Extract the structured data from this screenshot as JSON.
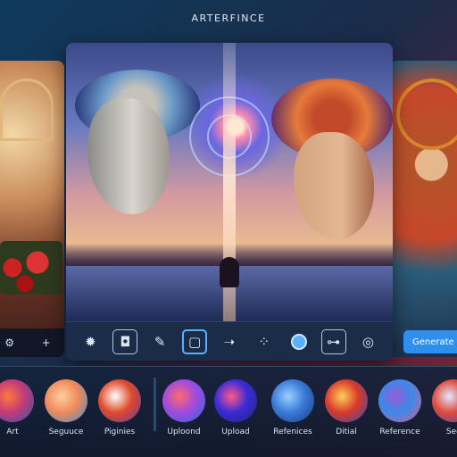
{
  "app": {
    "title": "ARTERFINCE"
  },
  "left_panel": {
    "tools": [
      {
        "icon": "settings-icon",
        "glyph": "⚙"
      },
      {
        "icon": "plus-icon",
        "glyph": "+"
      }
    ]
  },
  "main": {
    "toolbar": [
      {
        "icon": "sun-icon",
        "glyph": "✹"
      },
      {
        "icon": "crop-frame-icon",
        "glyph": "◘"
      },
      {
        "icon": "brush-icon",
        "glyph": "✎"
      },
      {
        "icon": "square-select-icon",
        "glyph": "▢"
      },
      {
        "icon": "arrow-right-icon",
        "glyph": "➝"
      },
      {
        "icon": "nodes-icon",
        "glyph": "⁘"
      },
      {
        "icon": "color-circle-icon",
        "glyph": ""
      },
      {
        "icon": "link-icon",
        "glyph": "⊶"
      },
      {
        "icon": "target-icon",
        "glyph": "◎"
      }
    ],
    "generate_label": "Generate"
  },
  "thumbnails": [
    {
      "label": "Art",
      "colors": [
        "#ff7a3a",
        "#c23a7a",
        "#2a5aa8"
      ]
    },
    {
      "label": "Seguuce",
      "colors": [
        "#ffd0a0",
        "#f08a5a",
        "#3a8ad8"
      ]
    },
    {
      "label": "Piginies",
      "colors": [
        "#ffffff",
        "#e04a2a",
        "#5a3aa8"
      ]
    },
    {
      "label": "Uploond",
      "colors": [
        "#ff6a6a",
        "#a04ae0",
        "#2a6ad8"
      ]
    },
    {
      "label": "Upload",
      "colors": [
        "#ff5a8a",
        "#3a2ad8",
        "#1a2a6a"
      ]
    },
    {
      "label": "Refenices",
      "colors": [
        "#9ad0ff",
        "#3a7ad8",
        "#1a3a7a"
      ]
    },
    {
      "label": "Ditial",
      "colors": [
        "#ffce5a",
        "#d83a2a",
        "#2a4ab8"
      ]
    },
    {
      "label": "Reference",
      "colors": [
        "#9a5ad8",
        "#3a8ae8",
        "#e05a8a"
      ]
    },
    {
      "label": "Sec",
      "colors": [
        "#e0e8ff",
        "#e04a3a",
        "#3a4ab8"
      ]
    }
  ],
  "colors": {
    "accent": "#2f8ff0",
    "panel": "#1b2c48"
  }
}
